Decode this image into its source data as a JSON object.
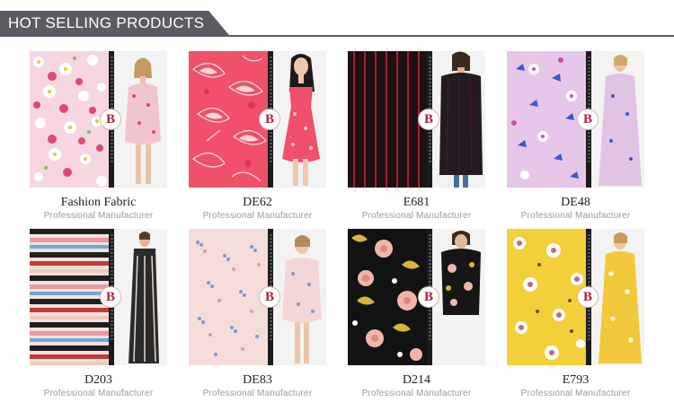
{
  "header": {
    "title": "HOT SELLING PRODUCTS"
  },
  "products": [
    {
      "code": "Fashion Fabric",
      "subtitle": "Professional Manufacturer",
      "pattern": "pink-daisy-floral",
      "logo": "B"
    },
    {
      "code": "DE62",
      "subtitle": "Professional Manufacturer",
      "pattern": "coral-leaf-print",
      "logo": "B"
    },
    {
      "code": "E681",
      "subtitle": "Professional Manufacturer",
      "pattern": "black-red-pinstripe",
      "logo": "B"
    },
    {
      "code": "DE48",
      "subtitle": "Professional Manufacturer",
      "pattern": "lilac-blue-floral",
      "logo": "B"
    },
    {
      "code": "D203",
      "subtitle": "Professional Manufacturer",
      "pattern": "multicolor-horizontal-stripe",
      "logo": "B"
    },
    {
      "code": "DE83",
      "subtitle": "Professional Manufacturer",
      "pattern": "blush-blue-sprig",
      "logo": "B"
    },
    {
      "code": "D214",
      "subtitle": "Professional Manufacturer",
      "pattern": "black-peony-floral",
      "logo": "B"
    },
    {
      "code": "E793",
      "subtitle": "Professional Manufacturer",
      "pattern": "yellow-floral",
      "logo": "B"
    }
  ],
  "colors": {
    "header": "#5b5b63",
    "logo": "#b2203d",
    "subtitle": "#9a9a9a"
  }
}
